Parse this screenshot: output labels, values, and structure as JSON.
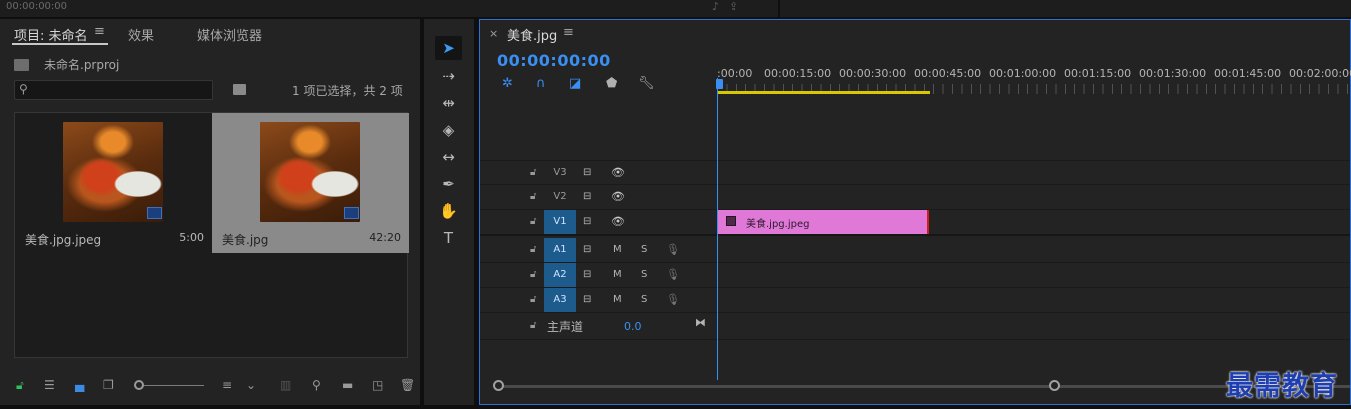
{
  "top_bar": {
    "timecode": "00:00:00:00",
    "icons": [
      "audio-icon",
      "export-icon"
    ]
  },
  "project_panel": {
    "tabs": {
      "project": "项目: 未命名",
      "menu": "≡",
      "effects": "效果",
      "media_browser": "媒体浏览器"
    },
    "project_file": "未命名.prproj",
    "search": {
      "value": "",
      "placeholder": ""
    },
    "selection_status": "1 项已选择，共 2 项",
    "clips": [
      {
        "name": "美食.jpg.jpeg",
        "duration": "5:00"
      },
      {
        "name": "美食.jpg",
        "duration": "42:20",
        "selected": true
      }
    ],
    "toolbar_icons": [
      "lock-icon",
      "list-view-icon",
      "icon-view-icon",
      "freeform-view-icon",
      "zoom-slider",
      "sort-icon",
      "automate-icon",
      "find-icon",
      "new-bin-icon",
      "new-item-icon",
      "delete-icon"
    ]
  },
  "tools": [
    "selection-tool",
    "track-select-tool",
    "ripple-edit-tool",
    "razor-tool",
    "slip-tool",
    "pen-tool",
    "hand-tool",
    "type-tool"
  ],
  "timeline": {
    "close": "×",
    "sequence_name": "美食.jpg",
    "menu": "≡",
    "timecode": "00:00:00:00",
    "ruler_labels": [
      ":00:00",
      "00:00:15:00",
      "00:00:30:00",
      "00:00:45:00",
      "00:01:00:00",
      "00:01:15:00",
      "00:01:30:00",
      "00:01:45:00",
      "00:02:00:00"
    ],
    "video_tracks": [
      {
        "name": "V3",
        "target": false
      },
      {
        "name": "V2",
        "target": false
      },
      {
        "name": "V1",
        "target": true
      }
    ],
    "audio_tracks": [
      {
        "name": "A1",
        "target": true,
        "mute": "M",
        "solo": "S"
      },
      {
        "name": "A2",
        "target": true,
        "mute": "M",
        "solo": "S"
      },
      {
        "name": "A3",
        "target": true,
        "mute": "M",
        "solo": "S"
      }
    ],
    "master": {
      "name": "主声道",
      "value": "0.0"
    },
    "clip_v1": {
      "label": "美食.jpg.jpeg"
    }
  },
  "watermark": "最需教育",
  "colors": {
    "accent_blue": "#3a8ff2",
    "clip_pink": "#e078d8",
    "workarea_yellow": "#d8c800",
    "track_target": "#1d5b8d"
  }
}
